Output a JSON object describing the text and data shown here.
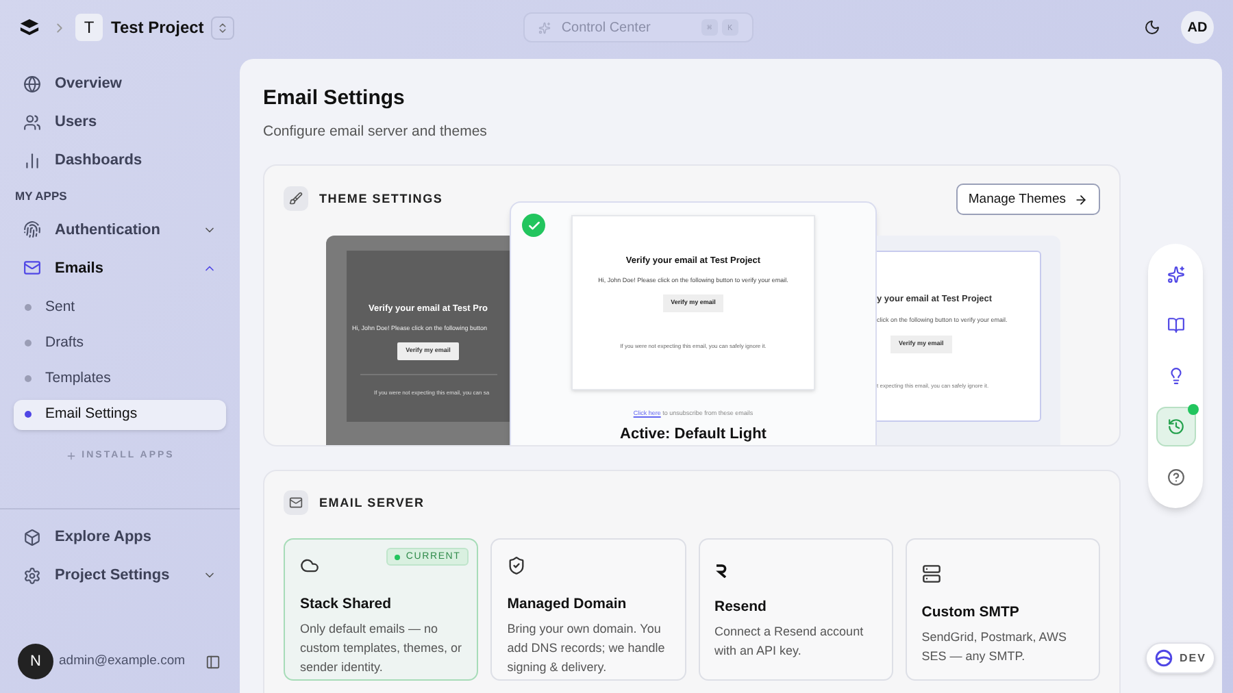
{
  "topbar": {
    "project_initial": "T",
    "project_name": "Test Project",
    "search": {
      "placeholder": "Control Center",
      "shortcut": [
        "⌘",
        "K"
      ]
    },
    "avatar": "AD"
  },
  "sidebar": {
    "items": [
      {
        "kind": "globe",
        "label": "Overview"
      },
      {
        "kind": "users",
        "label": "Users"
      },
      {
        "kind": "chart",
        "label": "Dashboards"
      }
    ],
    "section_title": "MY APPS",
    "apps": [
      {
        "kind": "fingerprint",
        "label": "Authentication",
        "expanded": false
      },
      {
        "kind": "mail",
        "label": "Emails",
        "expanded": true,
        "children": [
          {
            "label": "Sent",
            "selected": false
          },
          {
            "label": "Drafts",
            "selected": false
          },
          {
            "label": "Templates",
            "selected": false
          },
          {
            "label": "Email Settings",
            "selected": true
          }
        ]
      }
    ],
    "install_label": "INSTALL APPS",
    "bottom_items": [
      {
        "kind": "box",
        "label": "Explore Apps"
      },
      {
        "kind": "settings",
        "label": "Project Settings",
        "expanded": false
      }
    ],
    "user": {
      "initial": "N",
      "email": "admin@example.com"
    }
  },
  "page": {
    "title": "Email Settings",
    "subtitle": "Configure email server and themes"
  },
  "theme_settings": {
    "title": "THEME SETTINGS",
    "manage_button": "Manage Themes",
    "themes": [
      {
        "kind": "dark",
        "selected": false,
        "heading": "Verify your email at Test Pro",
        "body": "Hi, John Doe! Please click on the following button",
        "button": "Verify my email",
        "footer": "If you were not expecting this email, you can sa"
      },
      {
        "kind": "light",
        "selected": true,
        "heading": "Verify your email at Test Project",
        "body": "Hi, John Doe! Please click on the following button to verify your email.",
        "button": "Verify my email",
        "footer": "If you were not expecting this email, you can safely ignore it.",
        "unsubscribe_link": "Click here",
        "unsubscribe_text": "to unsubscribe from these emails",
        "caption": "Active: Default Light"
      },
      {
        "kind": "outline",
        "selected": false,
        "heading": "y your email at Test Project",
        "body": "click on the following button to verify your email.",
        "button": "Verify my email",
        "footer": "t expecting this email, you can safely ignore it."
      }
    ]
  },
  "email_server": {
    "title": "EMAIL SERVER",
    "current_badge": "CURRENT",
    "options": [
      {
        "kind": "cloud",
        "title": "Stack Shared",
        "description": "Only default emails — no custom templates, themes, or sender identity.",
        "selected": true
      },
      {
        "kind": "shield",
        "title": "Managed Domain",
        "description": "Bring your own domain. You add DNS records; we handle signing & delivery.",
        "selected": false
      },
      {
        "kind": "resend",
        "title": "Resend",
        "description": "Connect a Resend account with an API key.",
        "selected": false
      },
      {
        "kind": "server",
        "title": "Custom SMTP",
        "description": "SendGrid, Postmark, AWS SES — any SMTP.",
        "selected": false
      }
    ]
  },
  "toolbar": [
    {
      "kind": "sparkles",
      "selected": false
    },
    {
      "kind": "book",
      "selected": false
    },
    {
      "kind": "bulb",
      "selected": false
    },
    {
      "kind": "history",
      "selected": true,
      "notification": true
    },
    {
      "kind": "help",
      "selected": false
    }
  ],
  "env_badge": "DEV"
}
